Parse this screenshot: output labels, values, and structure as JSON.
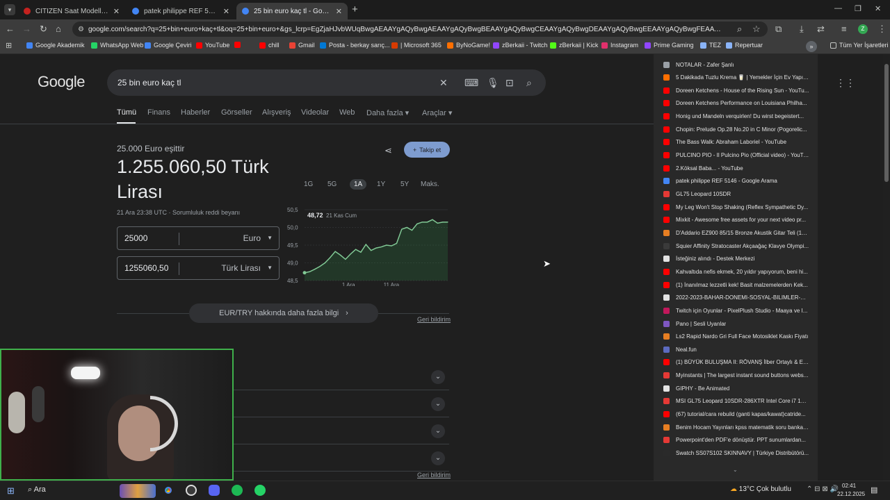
{
  "tabs": [
    {
      "title": "CITIZEN Saat Modelleri ve Fiyatları",
      "color": "#c5221f",
      "active": false
    },
    {
      "title": "patek philippe REF 5146 - Google'da Ara",
      "color": "#4285f4",
      "active": false
    },
    {
      "title": "25 bin euro kaç tl - Google'da Ara",
      "color": "#4285f4",
      "active": true
    }
  ],
  "url": "google.com/search?q=25+bin+euro+kaç+tl&oq=25+bin+euro+&gs_lcrp=EgZjaHJvbWUqBwgAEAAYgAQyBwgAEAAYgAQyBwgBEAAYgAQyBwgCEAAYgAQyBwgDEAAYgAQyBwgEEAAYgAQyBwgFEAAYgAQyBwgGEAAYgAQyBwgHEAAYgAQyBwgI...",
  "profile_initial": "Z",
  "bookmarks": [
    {
      "label": "Google Akademik",
      "color": "#4285f4"
    },
    {
      "label": "WhatsApp Web",
      "color": "#25d366"
    },
    {
      "label": "Google Çeviri",
      "color": "#4285f4"
    },
    {
      "label": "YouTube",
      "color": "#ff0000"
    },
    {
      "label": "",
      "color": "#ff0000"
    },
    {
      "label": "chill",
      "color": "#ff0000"
    },
    {
      "label": "Gmail",
      "color": "#ea4335"
    },
    {
      "label": "Posta - berkay sarıç...",
      "color": "#0078d4"
    },
    {
      "label": "| Microsoft 365",
      "color": "#d83b01"
    },
    {
      "label": "ByNoGame!",
      "color": "#ff6f00"
    },
    {
      "label": "zBerkaii - Twitch",
      "color": "#9146ff"
    },
    {
      "label": "zBerkaii | Kick",
      "color": "#53fc18"
    },
    {
      "label": "Instagram",
      "color": "#e1306c"
    },
    {
      "label": "Prime Gaming",
      "color": "#9146ff"
    },
    {
      "label": "TEZ",
      "color": "#8ab4f8"
    },
    {
      "label": "Repertuar",
      "color": "#8ab4f8"
    }
  ],
  "all_bookmarks_label": "Tüm Yer İşaretleri",
  "search": {
    "query": "25 bin euro kaç tl"
  },
  "logo_text": "Google",
  "nav_tabs": [
    "Tümü",
    "Finans",
    "Haberler",
    "Görseller",
    "Alışveriş",
    "Videolar",
    "Web",
    "Daha fazla",
    "Araçlar"
  ],
  "result": {
    "equals_label": "25.000 Euro eşittir",
    "value_line1": "1.255.060,50 Türk",
    "value_line2": "Lirası",
    "timestamp": "21 Ara 23:38 UTC · Sorumluluk reddi beyanı",
    "follow_label": "Takip et",
    "from_value": "25000",
    "from_unit": "Euro",
    "to_value": "1255060,50",
    "to_unit": "Türk Lirası",
    "more_info": "EUR/TRY hakkında daha fazla bilgi",
    "feedback": "Geri bildirim",
    "feedback2": "Geri bildirim"
  },
  "ranges": [
    "1G",
    "5G",
    "1A",
    "1Y",
    "5Y",
    "Maks."
  ],
  "chart_data": {
    "type": "line",
    "tooltip_value": "48,72",
    "tooltip_date": "21 Kas Cum",
    "y_ticks": [
      "50,5",
      "50,0",
      "49,5",
      "49,0",
      "48,5"
    ],
    "ylim": [
      48.5,
      50.5
    ],
    "x_ticks": [
      "1 Ara",
      "11 Ara"
    ],
    "values": [
      48.72,
      48.75,
      48.82,
      48.9,
      49.0,
      49.15,
      49.32,
      49.22,
      49.1,
      49.25,
      49.38,
      49.3,
      49.52,
      49.35,
      49.42,
      49.45,
      49.5,
      49.48,
      49.55,
      49.95,
      50.0,
      49.92,
      50.1,
      50.15,
      50.15,
      50.22,
      50.12,
      50.15,
      50.15
    ]
  },
  "dropdown": [
    {
      "label": "NOTALAR - Zafer Şanlı",
      "color": "#9aa0a6"
    },
    {
      "label": "5 Dakikada Tuzlu Krema 🥛 | Yemekler İçin Ev Yapımı...",
      "color": "#ff6f00"
    },
    {
      "label": "Doreen Ketchens - House of the Rising Sun - YouTu...",
      "color": "#ff0000"
    },
    {
      "label": "Doreen Ketchens Performance on Louisiana Philha...",
      "color": "#ff0000"
    },
    {
      "label": "Honig und Mandeln verquirlen! Du wirst begeistert...",
      "color": "#ff0000"
    },
    {
      "label": "Chopin: Prelude Op.28 No.20 in C Minor (Pogorelic...",
      "color": "#ff0000"
    },
    {
      "label": "The Bass Walk: Abraham Laboriel - YouTube",
      "color": "#ff0000"
    },
    {
      "label": "PULCINO PIO - Il Pulcino Pio (Official video) - YouTu...",
      "color": "#ff0000"
    },
    {
      "label": "2.Köksal Baba... - YouTube",
      "color": "#ff0000"
    },
    {
      "label": "patek philippe REF 5146 - Google Arama",
      "color": "#4285f4"
    },
    {
      "label": "GL75 Leopard 10SDR",
      "color": "#e53935"
    },
    {
      "label": "My Leg Won't Stop Shaking (Reflex Sympathetic Dy...",
      "color": "#ff0000"
    },
    {
      "label": "Mixkit - Awesome free assets for your next video pr...",
      "color": "#ff0000"
    },
    {
      "label": "D'Addario EZ900 85/15 Bronze Akustik Gitar Teli (10...",
      "color": "#e67e22"
    },
    {
      "label": "Squier Affinity Stratocaster Akçaağaç Klavye Olympi...",
      "color": "#3a3a3a"
    },
    {
      "label": "İsteğiniz alındı - Destek Merkezi",
      "color": "#e3e3e3"
    },
    {
      "label": "Kahvaltıda nefis ekmek, 20 yıldır yapıyorum, beni hi...",
      "color": "#ff0000"
    },
    {
      "label": "(1) İnanılmaz lezzetli kek! Basit malzemelerden Kek...",
      "color": "#ff0000"
    },
    {
      "label": "2022-2023-BAHAR-DONEMI-SOSYAL-BILIMLER-EN...",
      "color": "#e3e3e3"
    },
    {
      "label": "Twitch için Oyunlar - PixelPlush Studio - Maaya ve I...",
      "color": "#c2185b"
    },
    {
      "label": "Pano | Sesli Uyanlar",
      "color": "#7e57c2"
    },
    {
      "label": "Ls2 Rapid Nardo Gri Full Face Motosiklet Kaskı Fiyatı",
      "color": "#e67e22"
    },
    {
      "label": "Neal.fun",
      "color": "#5c6bc0"
    },
    {
      "label": "(1) BÜYÜK BULUŞMA II: RÖVANŞ İlber Ortaylı & Emr...",
      "color": "#ff0000"
    },
    {
      "label": "Myinstants | The largest instant sound buttons webs...",
      "color": "#e53935"
    },
    {
      "label": "GIPHY - Be Animated",
      "color": "#e3e3e3"
    },
    {
      "label": "MSI GL75 Leopard 10SDR-286XTR Intel Core i7 107...",
      "color": "#e53935"
    },
    {
      "label": "(67) tutorial/cara rebuild (ganti kapas/kawat)catride...",
      "color": "#ff0000"
    },
    {
      "label": "Benim Hocam Yayınları kpss matematik soru bankas...",
      "color": "#e67e22"
    },
    {
      "label": "Powerpoint'den PDF'e dönüştür. PPT sunumlardan...",
      "color": "#e53935"
    },
    {
      "label": "Swatch SS07S102 SKINNAVY | Türkiye Distribütörü...",
      "color": "#2a2a2a"
    }
  ],
  "taskbar": {
    "search_label": "Ara",
    "weather": "13°C  Çok bulutlu",
    "time": "02:41",
    "date": "22.12.2025"
  }
}
